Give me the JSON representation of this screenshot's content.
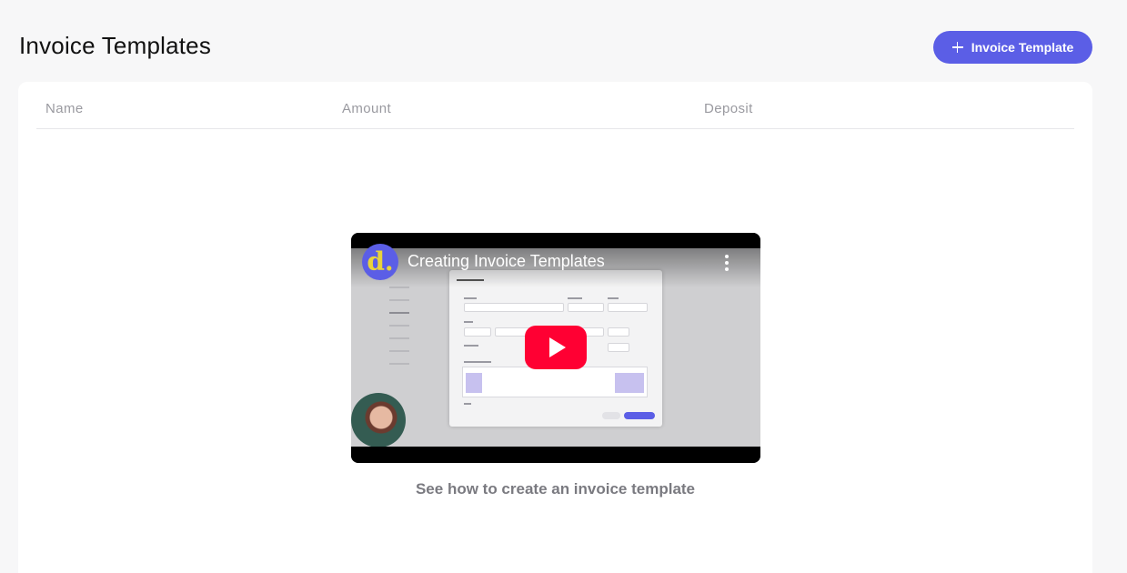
{
  "header": {
    "title": "Invoice Templates",
    "add_button_label": "Invoice Template"
  },
  "table": {
    "columns": [
      "Name",
      "Amount",
      "Deposit"
    ]
  },
  "empty_state": {
    "video": {
      "title": "Creating Invoice Templates",
      "logo_letter": "d."
    },
    "caption": "See how to create an invoice template"
  },
  "colors": {
    "accent": "#5b5ee6",
    "play_button": "#ff0033",
    "background": "#f7f7f8"
  },
  "icons": {
    "add": "plus-icon",
    "play": "play-icon",
    "more": "more-vertical-icon"
  }
}
